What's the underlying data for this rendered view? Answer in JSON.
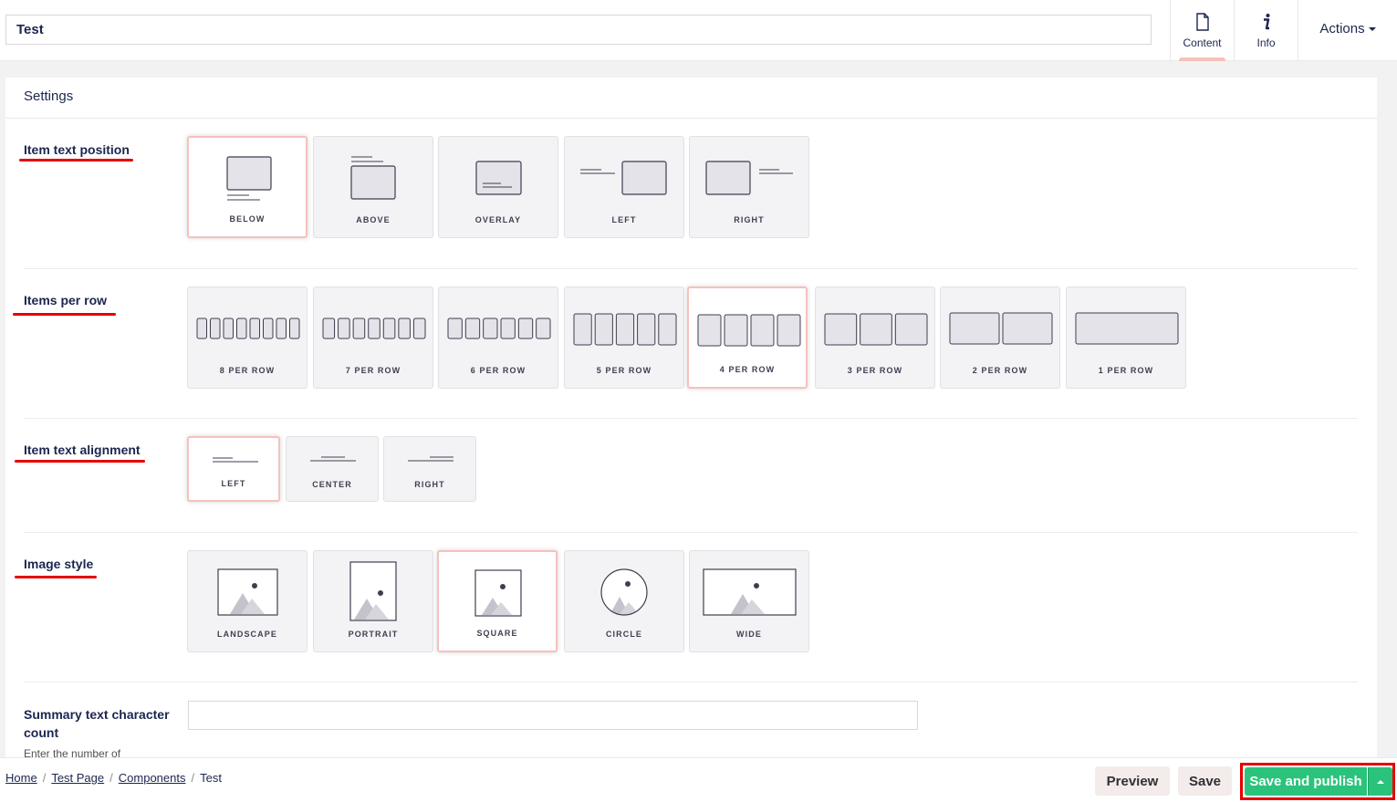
{
  "header": {
    "name_value": "Test",
    "apps": [
      {
        "label": "Content",
        "icon": "document-icon"
      },
      {
        "label": "Info",
        "icon": "info-icon"
      }
    ],
    "actions_label": "Actions"
  },
  "panel": {
    "title": "Settings",
    "text_position": {
      "label": "Item text position",
      "options": [
        "BELOW",
        "ABOVE",
        "OVERLAY",
        "LEFT",
        "RIGHT"
      ],
      "selected": "BELOW"
    },
    "items_per_row": {
      "label": "Items per row",
      "options": [
        "8 PER ROW",
        "7 PER ROW",
        "6 PER ROW",
        "5 PER ROW",
        "4 PER ROW",
        "3 PER ROW",
        "2 PER ROW",
        "1 PER ROW"
      ],
      "selected": "4 PER ROW"
    },
    "text_alignment": {
      "label": "Item text alignment",
      "options": [
        "LEFT",
        "CENTER",
        "RIGHT"
      ],
      "selected": "LEFT"
    },
    "image_style": {
      "label": "Image style",
      "options": [
        "LANDSCAPE",
        "PORTRAIT",
        "SQUARE",
        "CIRCLE",
        "WIDE"
      ],
      "selected": "SQUARE"
    },
    "summary": {
      "label": "Summary text character count",
      "help": "Enter the number of",
      "value": ""
    }
  },
  "footer": {
    "breadcrumb": [
      "Home",
      "Test Page",
      "Components",
      "Test"
    ],
    "preview_label": "Preview",
    "save_label": "Save",
    "save_publish_label": "Save and publish"
  },
  "colors": {
    "selected_border": "#f5c1bc",
    "highlight_red": "#e60000",
    "publish_green": "#2bc37c",
    "text_navy": "#1b264f"
  }
}
